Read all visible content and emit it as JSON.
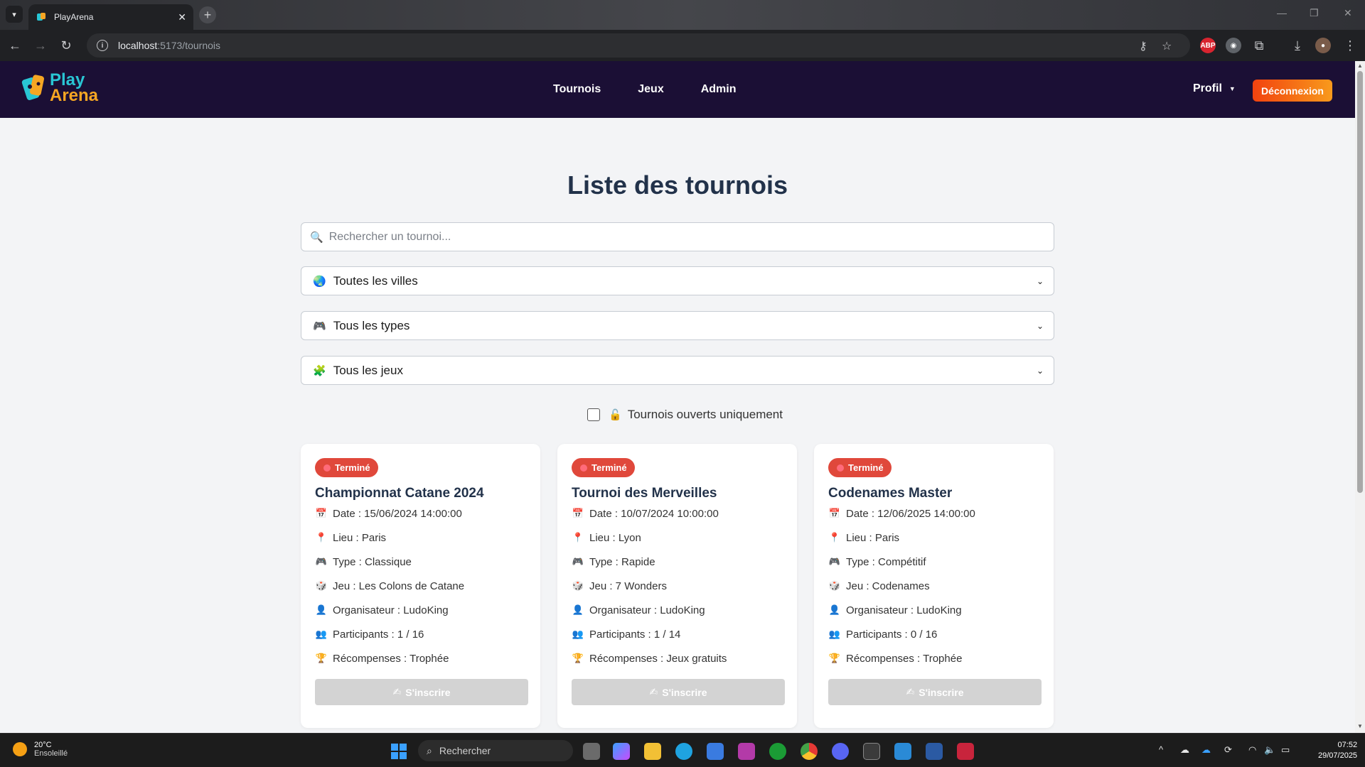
{
  "browser": {
    "tab_title": "PlayArena",
    "url_host": "localhost",
    "url_path": ":5173/tournois"
  },
  "header": {
    "logo_line1": "Play",
    "logo_line2": "Arena",
    "nav": [
      "Tournois",
      "Jeux",
      "Admin"
    ],
    "profile_label": "Profil",
    "logout_label": "Déconnexion"
  },
  "page": {
    "title": "Liste des tournois",
    "search_placeholder": "Rechercher un tournoi...",
    "filter_city": "Toutes les villes",
    "filter_type": "Tous les types",
    "filter_game": "Tous les jeux",
    "open_only_label": "Tournois ouverts uniquement"
  },
  "tournaments": [
    {
      "status": "Terminé",
      "title": "Championnat Catane 2024",
      "date": "Date : 15/06/2024 14:00:00",
      "place": "Lieu : Paris",
      "type": "Type : Classique",
      "game": "Jeu : Les Colons de Catane",
      "organizer": "Organisateur : LudoKing",
      "participants": "Participants : 1 / 16",
      "rewards": "Récompenses : Trophée",
      "button": "S'inscrire"
    },
    {
      "status": "Terminé",
      "title": "Tournoi des Merveilles",
      "date": "Date : 10/07/2024 10:00:00",
      "place": "Lieu : Lyon",
      "type": "Type : Rapide",
      "game": "Jeu : 7 Wonders",
      "organizer": "Organisateur : LudoKing",
      "participants": "Participants : 1 / 14",
      "rewards": "Récompenses : Jeux gratuits",
      "button": "S'inscrire"
    },
    {
      "status": "Terminé",
      "title": "Codenames Master",
      "date": "Date : 12/06/2025 14:00:00",
      "place": "Lieu : Paris",
      "type": "Type : Compétitif",
      "game": "Jeu : Codenames",
      "organizer": "Organisateur : LudoKing",
      "participants": "Participants : 0 / 16",
      "rewards": "Récompenses : Trophée",
      "button": "S'inscrire"
    }
  ],
  "taskbar": {
    "weather_temp": "20°C",
    "weather_desc": "Ensoleillé",
    "search_label": "Rechercher",
    "time": "07:52",
    "date": "29/07/2025"
  },
  "colors": {
    "header_bg": "#1b0f35",
    "logout_gradient": [
      "#f2420f",
      "#f89a1c"
    ],
    "badge_red": "#e0483b",
    "title_color": "#22324a"
  }
}
